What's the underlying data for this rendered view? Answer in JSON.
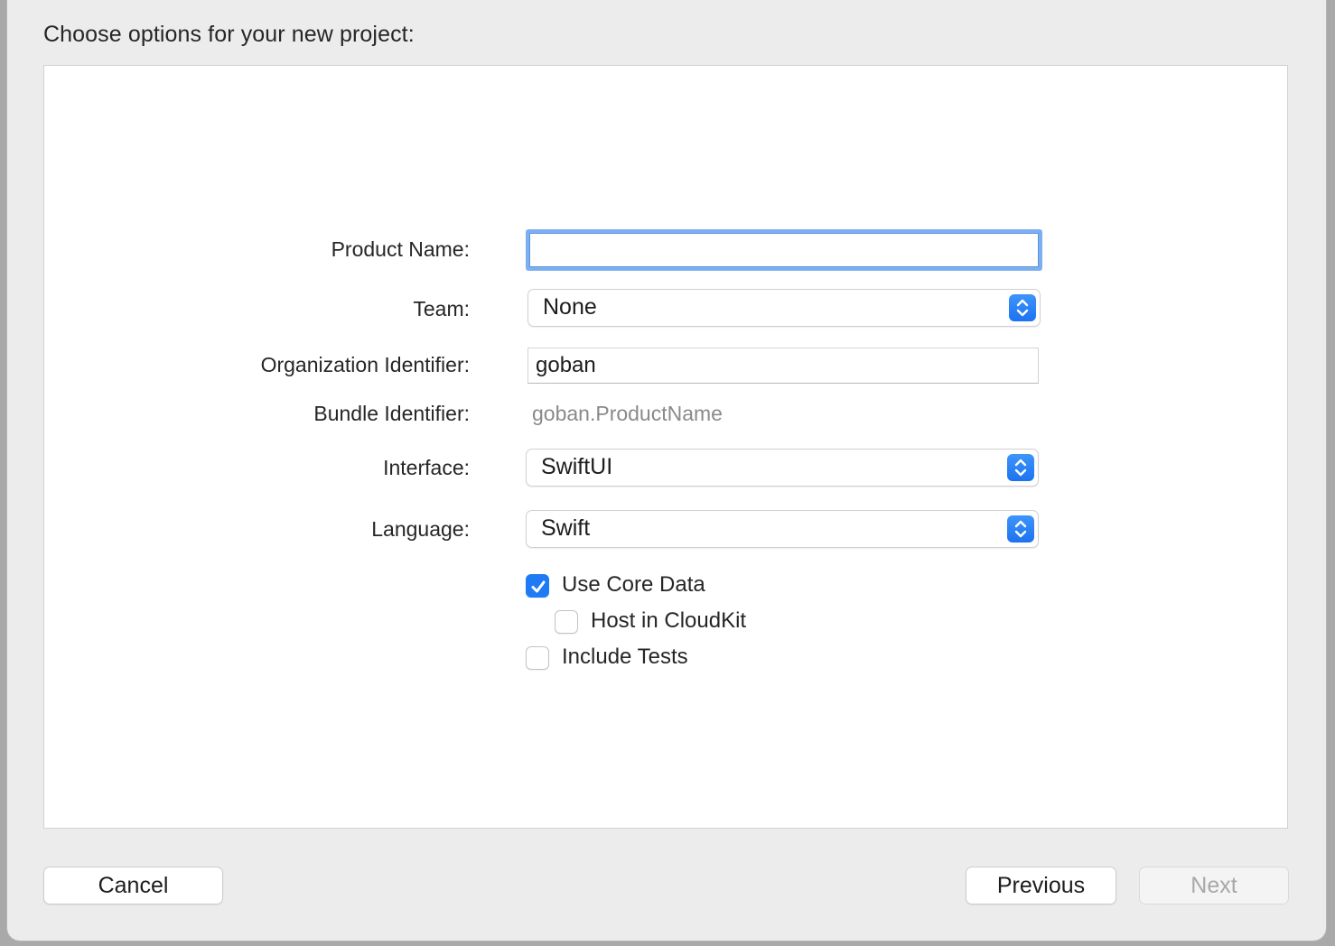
{
  "dialog": {
    "title": "Choose options for your new project:"
  },
  "form": {
    "product_name": {
      "label": "Product Name:",
      "value": ""
    },
    "team": {
      "label": "Team:",
      "value": "None"
    },
    "organization_identifier": {
      "label": "Organization Identifier:",
      "value": "goban"
    },
    "bundle_identifier": {
      "label": "Bundle Identifier:",
      "value": "goban.ProductName"
    },
    "interface": {
      "label": "Interface:",
      "value": "SwiftUI"
    },
    "language": {
      "label": "Language:",
      "value": "Swift"
    },
    "options": [
      {
        "label": "Use Core Data",
        "checked": true
      },
      {
        "label": "Host in CloudKit",
        "checked": false
      },
      {
        "label": "Include Tests",
        "checked": false
      }
    ]
  },
  "buttons": {
    "cancel": "Cancel",
    "previous": "Previous",
    "next": "Next"
  },
  "colors": {
    "accent": "#1f7af5",
    "focus_ring": "#7daff0",
    "disabled_text": "#a8a8a8"
  }
}
